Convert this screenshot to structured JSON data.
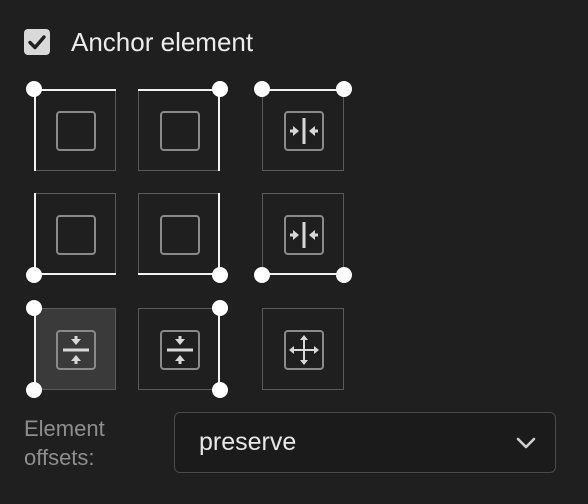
{
  "anchor": {
    "checked": true,
    "label": "Anchor element"
  },
  "grid": {
    "cells": [
      {
        "name": "anchor-top-left",
        "icon": "square-icon",
        "edges": [
          "top",
          "left"
        ],
        "dots": [
          "tl"
        ],
        "selected": false
      },
      {
        "name": "anchor-top-right",
        "icon": "square-icon",
        "edges": [
          "top",
          "right"
        ],
        "dots": [
          "tr"
        ],
        "selected": false
      },
      {
        "name": "anchor-top-stretch",
        "icon": "stretch-horizontal-icon",
        "edges": [
          "top"
        ],
        "dots": [
          "tl",
          "tr"
        ],
        "selected": false
      },
      {
        "name": "anchor-bottom-left",
        "icon": "square-icon",
        "edges": [
          "bottom",
          "left"
        ],
        "dots": [
          "bl"
        ],
        "selected": false
      },
      {
        "name": "anchor-bottom-right",
        "icon": "square-icon",
        "edges": [
          "bottom",
          "right"
        ],
        "dots": [
          "br"
        ],
        "selected": false
      },
      {
        "name": "anchor-bottom-stretch",
        "icon": "stretch-horizontal-icon",
        "edges": [
          "bottom"
        ],
        "dots": [
          "bl",
          "br"
        ],
        "selected": false
      },
      {
        "name": "anchor-left-stretch",
        "icon": "stretch-vertical-icon",
        "edges": [
          "left"
        ],
        "dots": [
          "tl",
          "bl"
        ],
        "selected": true
      },
      {
        "name": "anchor-right-stretch",
        "icon": "stretch-vertical-icon",
        "edges": [
          "right"
        ],
        "dots": [
          "tr",
          "br"
        ],
        "selected": false
      },
      {
        "name": "anchor-stretch-both",
        "icon": "stretch-both-icon",
        "edges": [],
        "dots": [],
        "selected": false
      }
    ]
  },
  "offsets": {
    "label": "Element offsets:",
    "value": "preserve"
  },
  "colors": {
    "background": "#1f1f1f",
    "border": "#5a5a5a",
    "accent": "#ffffff",
    "selected": "#3a3a3a"
  }
}
